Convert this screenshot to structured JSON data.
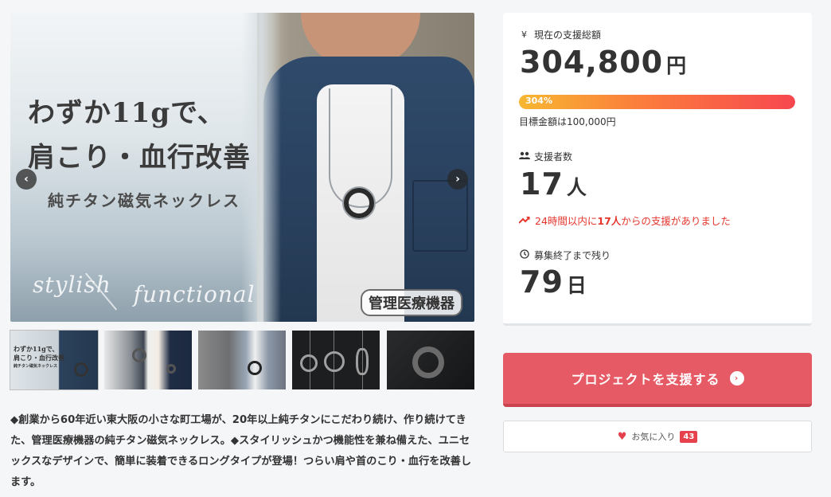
{
  "gallery": {
    "headline_line1": "わずか11gで、",
    "headline_line2": "肩こり・血行改善",
    "subline": "純チタン磁気ネックレス",
    "stylish_text": "stylish",
    "functional_text": "functional",
    "medical_badge": "管理医療機器",
    "prev_icon": "‹",
    "next_icon": "›",
    "thumb1_line1": "わずか11gで、",
    "thumb1_line2": "肩こり・血行改善",
    "thumb1_line3": "純チタン磁気ネックレス"
  },
  "description": "◆創業から60年近い東大阪の小さな町工場が、20年以上純チタンにこだわり続け、作り続けてきた、管理医療機器の純チタン磁気ネックレス。◆スタイリッシュかつ機能性を兼ね備えた、ユニセックスなデザインで、簡単に装着できるロングタイプが登場！つらい肩や首のこり・血行を改善します。",
  "stats": {
    "total_label": "現在の支援総額",
    "total_icon": "¥",
    "total_value": "304,800",
    "total_unit": "円",
    "progress_text": "304%",
    "progress_fraction": 1.0,
    "goal_text": "目標金額は100,000円",
    "supporters_label": "支援者数",
    "supporters_icon": "people-icon",
    "supporters_value": "17",
    "supporters_unit": "人",
    "trend_prefix": "24時間以内に",
    "trend_count": "17人",
    "trend_suffix": "からの支援がありました",
    "remaining_label": "募集終了まで残り",
    "remaining_value": "79",
    "remaining_unit": "日"
  },
  "actions": {
    "support_label": "プロジェクトを支援する",
    "favorite_label": "お気に入り",
    "favorite_count": "43"
  },
  "colors": {
    "accent": "#e65a65",
    "trend": "#e5352d",
    "progress_start": "#f7b731",
    "progress_end": "#f7474f"
  }
}
